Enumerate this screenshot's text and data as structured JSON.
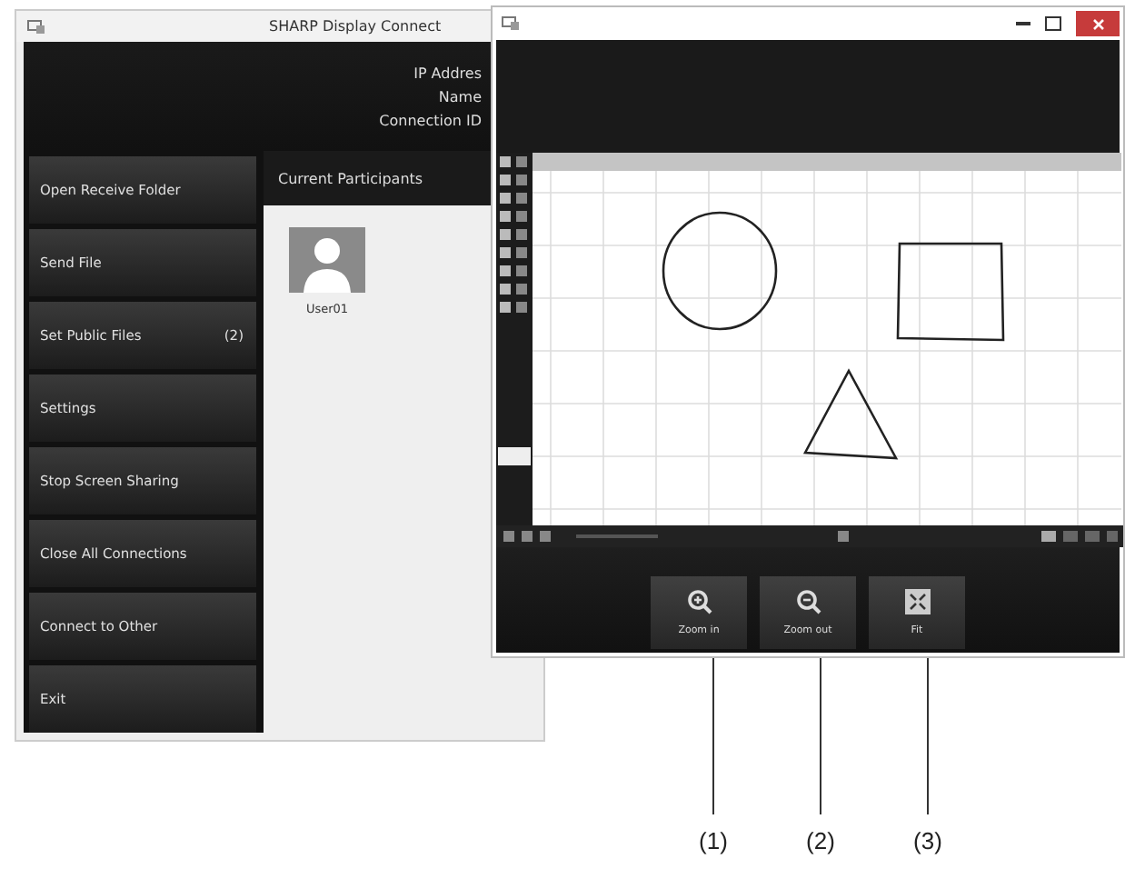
{
  "main_window": {
    "title": "SHARP Display Connect",
    "info_labels": [
      "IP Addres",
      "Name",
      "Connection ID"
    ],
    "menu": [
      {
        "label": "Open Receive Folder"
      },
      {
        "label": "Send File"
      },
      {
        "label": "Set Public Files",
        "count": "(2)"
      },
      {
        "label": "Settings"
      },
      {
        "label": "Stop Screen Sharing"
      },
      {
        "label": "Close All Connections"
      },
      {
        "label": "Connect to Other"
      },
      {
        "label": "Exit"
      }
    ],
    "participants": {
      "heading": "Current Participants",
      "users": [
        {
          "name": "User01"
        }
      ]
    }
  },
  "viewer_window": {
    "buttons": [
      {
        "label": "Zoom in",
        "kind": "zoom-in"
      },
      {
        "label": "Zoom out",
        "kind": "zoom-out"
      },
      {
        "label": "Fit",
        "kind": "fit"
      }
    ]
  },
  "callouts": [
    "(1)",
    "(2)",
    "(3)"
  ]
}
